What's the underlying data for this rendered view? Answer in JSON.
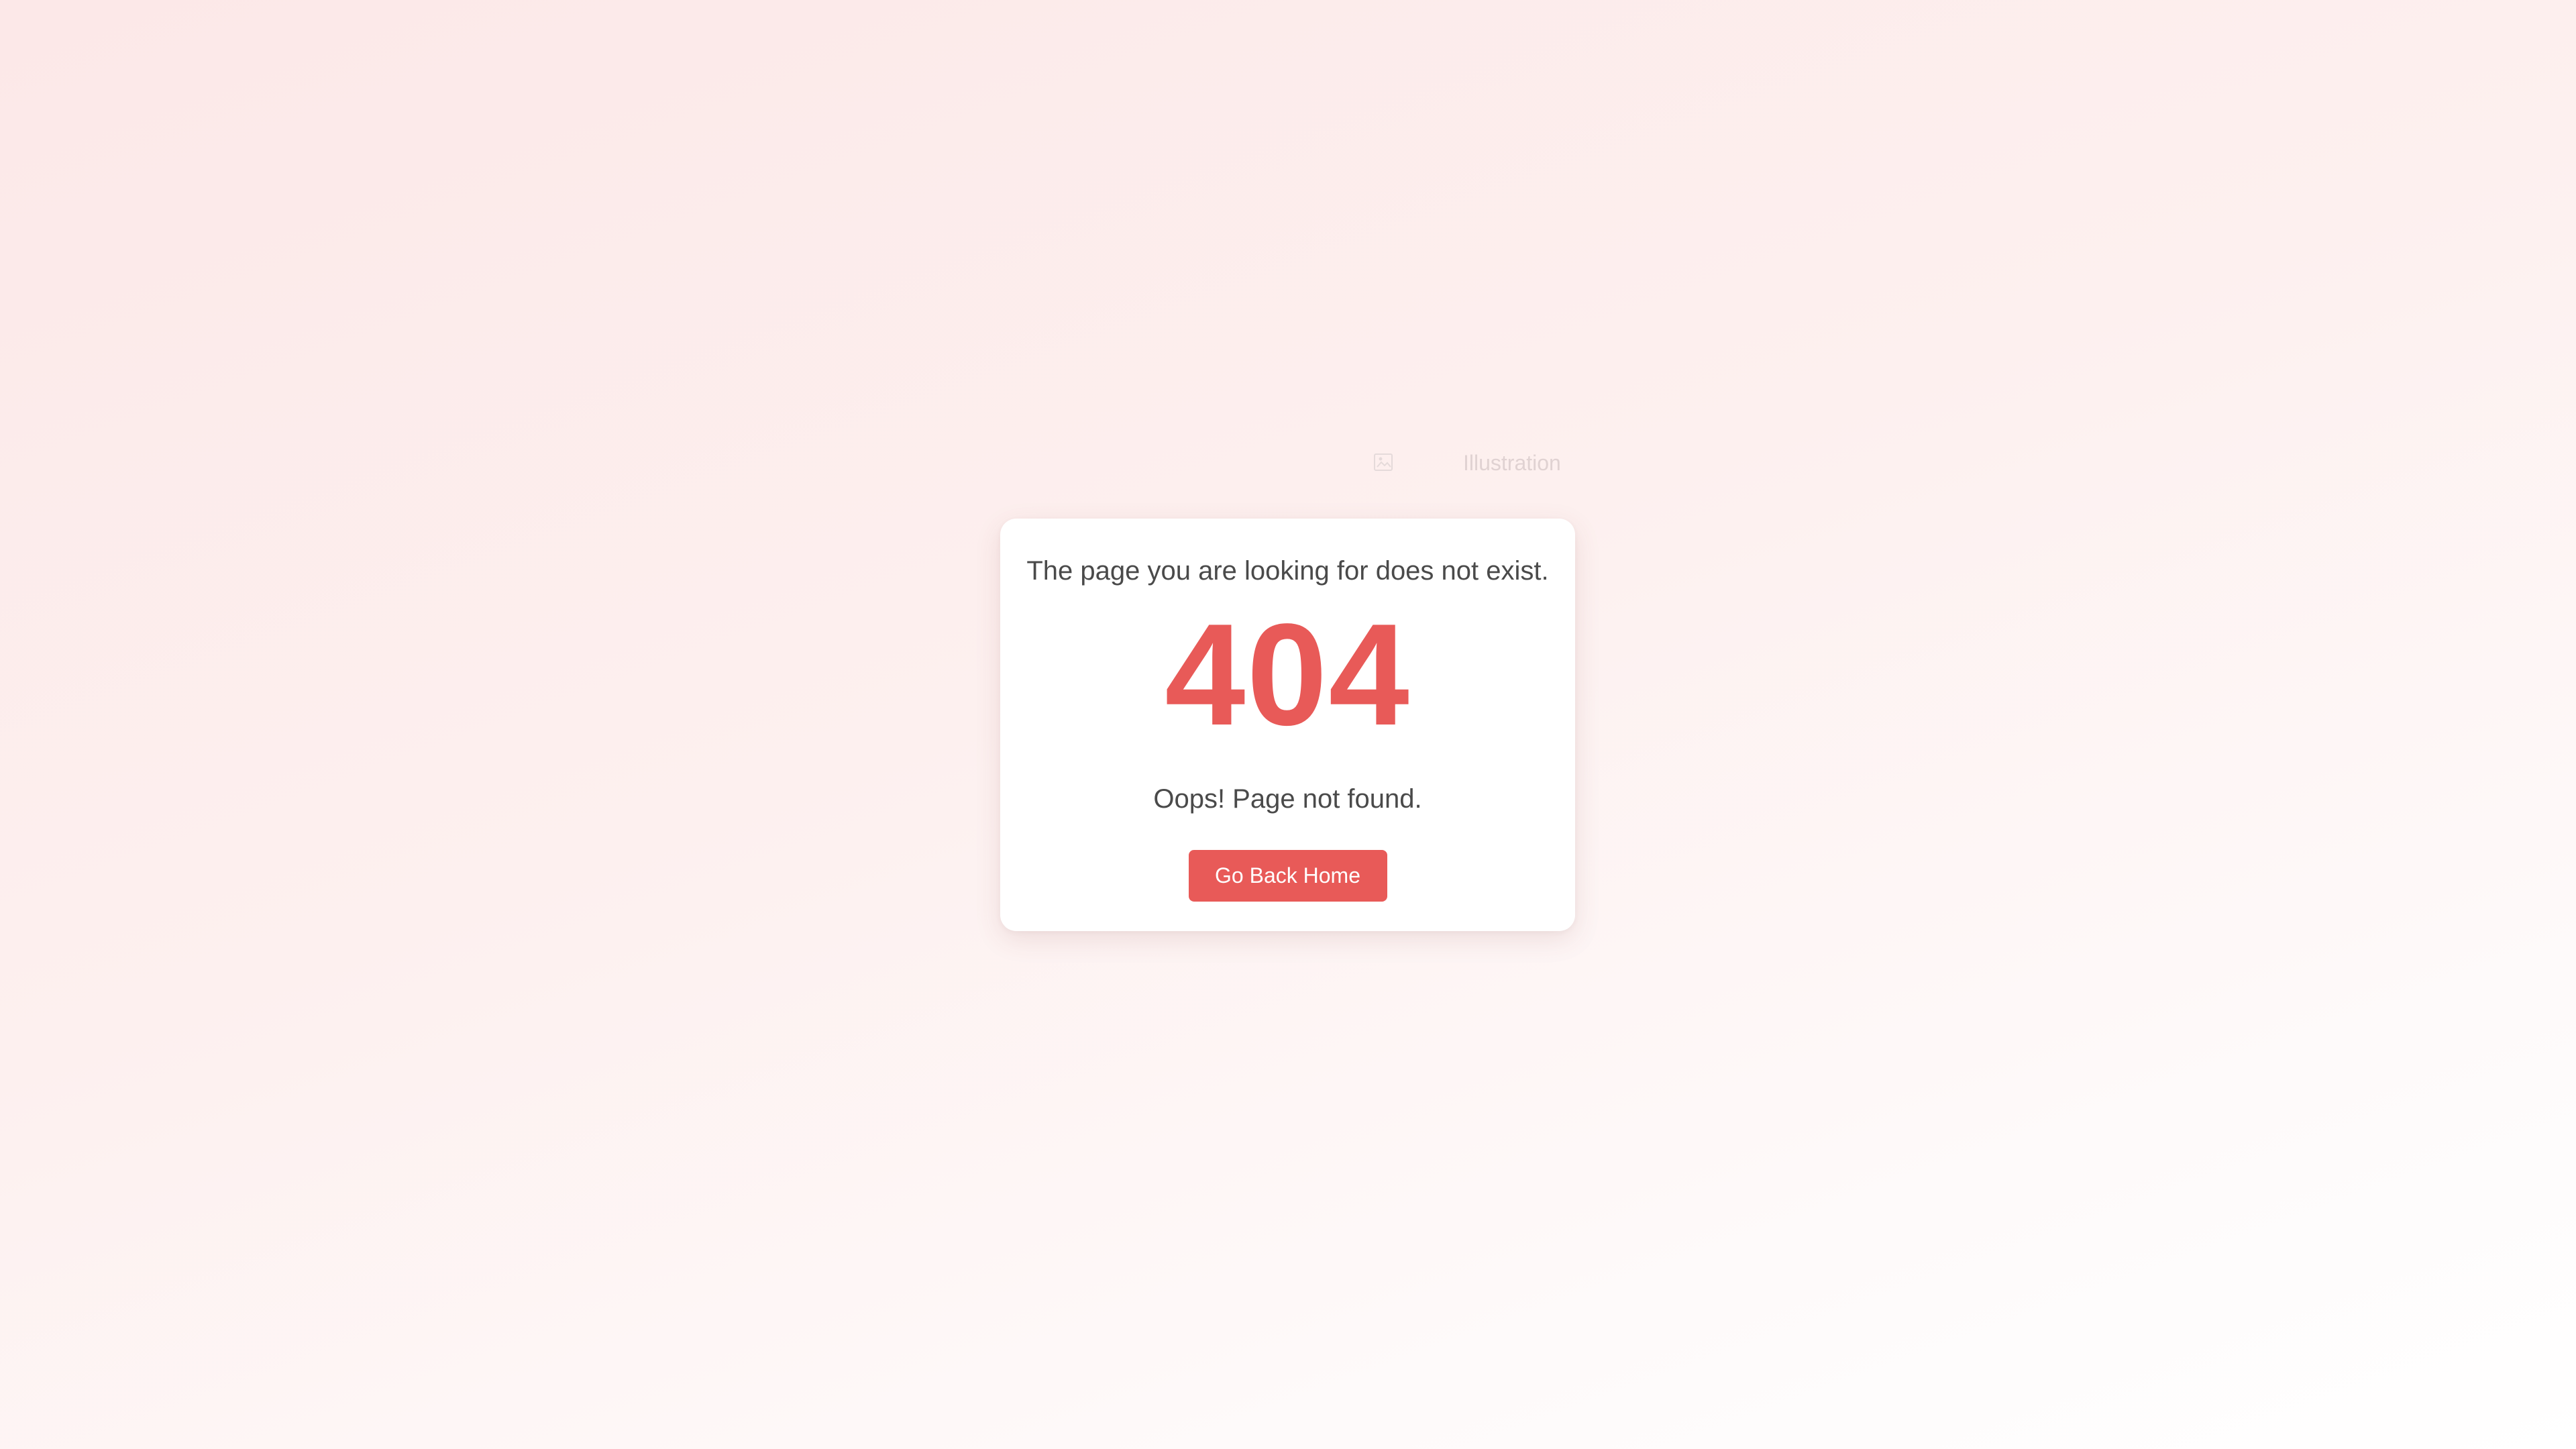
{
  "illustration": {
    "alt_text": "Illustration",
    "icon": "broken-image-icon"
  },
  "card": {
    "message": "The page you are looking for does not exist.",
    "error_code": "404",
    "subtitle": "Oops! Page not found.",
    "button_label": "Go Back Home"
  },
  "colors": {
    "accent": "#e85a58",
    "text": "#4a4a4a",
    "card_bg": "#ffffff",
    "page_bg_start": "#fce8e8",
    "page_bg_end": "#ffffff"
  }
}
